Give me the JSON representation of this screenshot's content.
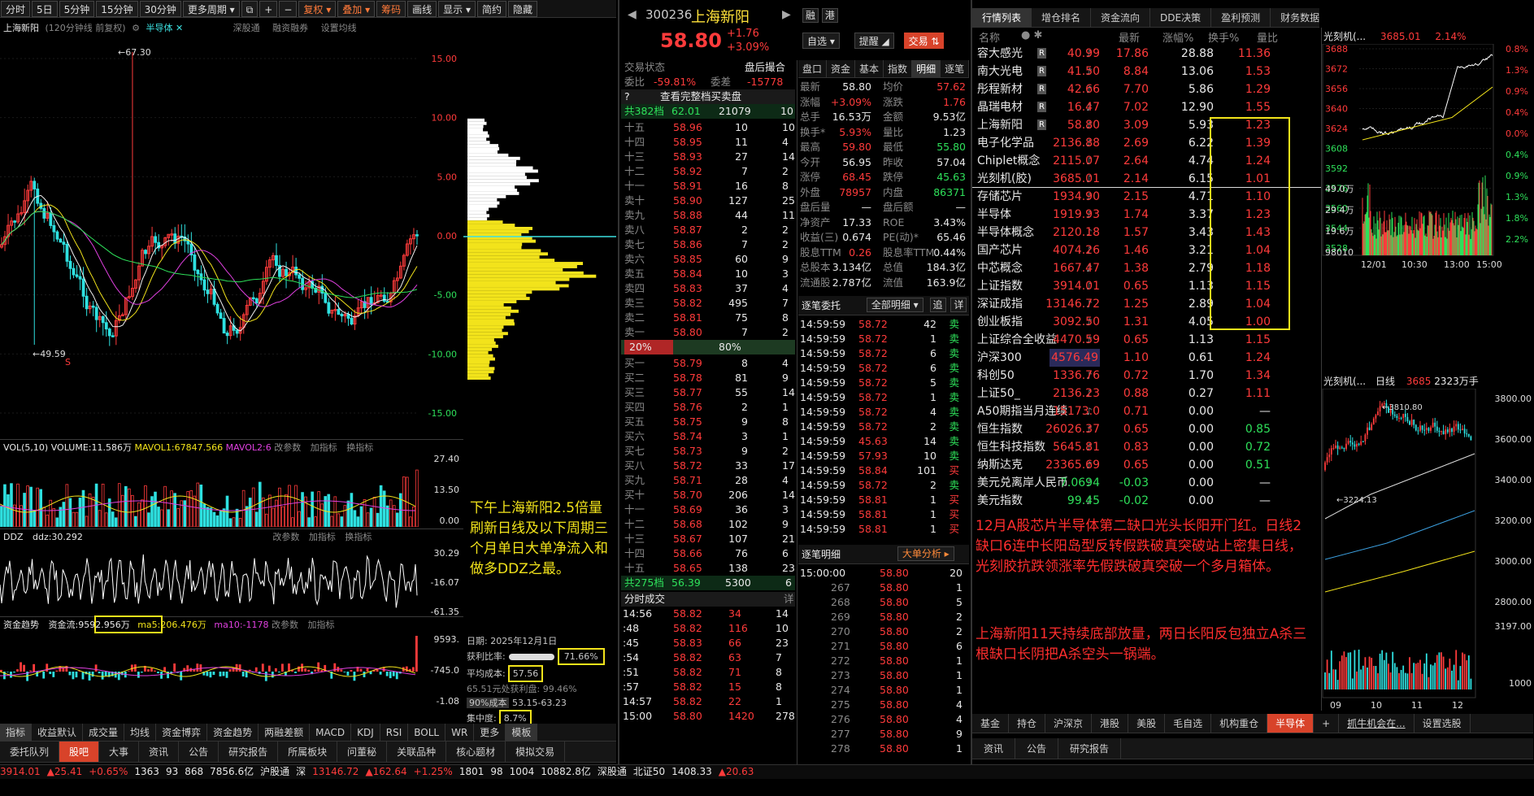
{
  "left": {
    "toolbar": [
      "分时",
      "5日",
      "5分钟",
      "15分钟",
      "30分钟",
      "更多周期",
      "",
      "+",
      "−",
      "复权",
      "叠加",
      "筹码",
      "画线",
      "显示",
      "简约",
      "隐藏"
    ],
    "title": "上海新阳",
    "subtitle": "(120分钟线 前复权)",
    "sector": "半导体",
    "links": [
      "深股通",
      "融资融券",
      "设置均线"
    ],
    "y_labels": [
      "15.00",
      "10.00",
      "5.00",
      "0.00",
      "-5.00",
      "-10.00",
      "-15.00"
    ],
    "high_mark": "67.30",
    "low_mark": "49.59",
    "vol_hdr": {
      "name": "VOL(5,10)",
      "vol": "VOLUME:11.586万",
      "ma1": "MAVOL1:67847.566",
      "ma2": "MAVOL2:6",
      "change": "改参数",
      "add": "加指标",
      "swap": "换指标"
    },
    "vol_y": [
      "27.40",
      "13.50",
      "0.00"
    ],
    "ddz_hdr": {
      "name": "DDZ",
      "val": "ddz:30.292"
    },
    "ddz_y": [
      "30.29",
      "-16.07",
      "-61.35"
    ],
    "flow_hdr": {
      "name": "资金趋势",
      "val": "资金流:9592.956万",
      "ma5": "ma5:206.476万",
      "ma10": "ma10:-1178"
    },
    "flow_y": [
      "9593.",
      "-745.0",
      "-1.08"
    ],
    "chip_info": {
      "date": "日期: 2025年12月1日",
      "ratio_label": "获利比率:",
      "ratio": "71.66%",
      "cost_label": "平均成本:",
      "cost": "57.56",
      "profit_line": "65.51元处获利盘: 99.46%",
      "cost90": "90%成本",
      "cost90_range": "53.15-63.23",
      "conc_label": "集中度:",
      "conc": "8.7%"
    },
    "annotation": "下午上海新阳2.5倍量刷新日线及以下周期三个月单日大单净流入和做多DDZ之最。",
    "bottom_tabs": [
      "指标",
      "收益默认",
      "成交量",
      "均线",
      "资金博弈",
      "资金趋势",
      "两融差额",
      "MACD",
      "KDJ",
      "RSI",
      "BOLL",
      "WR",
      "更多",
      "模板"
    ]
  },
  "quote": {
    "code": "300236",
    "name": "上海新阳",
    "price": "58.80",
    "chg": "+1.76",
    "pct": "+3.09%",
    "btns": [
      "融",
      "港",
      "自选",
      "提醒",
      "交易"
    ],
    "state_label": "交易状态",
    "state": "盘后撮合",
    "webi": "委比",
    "webi_v": "-59.81%",
    "weicha": "委差",
    "weicha_v": "-15778",
    "full_btn": "查看完整档买卖盘",
    "sell_total": "共382档",
    "sell_total_p": "62.01",
    "sell_total_v": "21079",
    "sell_total_n": "10",
    "sells": [
      [
        "十五",
        "58.96",
        "10",
        "10"
      ],
      [
        "十四",
        "58.95",
        "11",
        "4"
      ],
      [
        "十三",
        "58.93",
        "27",
        "14"
      ],
      [
        "十二",
        "58.92",
        "7",
        "2"
      ],
      [
        "十一",
        "58.91",
        "16",
        "8"
      ],
      [
        "卖十",
        "58.90",
        "127",
        "25"
      ],
      [
        "卖九",
        "58.88",
        "44",
        "11"
      ],
      [
        "卖八",
        "58.87",
        "2",
        "2"
      ],
      [
        "卖七",
        "58.86",
        "7",
        "2"
      ],
      [
        "卖六",
        "58.85",
        "60",
        "9"
      ],
      [
        "卖五",
        "58.84",
        "10",
        "3"
      ],
      [
        "卖四",
        "58.83",
        "37",
        "4"
      ],
      [
        "卖三",
        "58.82",
        "495",
        "7"
      ],
      [
        "卖二",
        "58.81",
        "75",
        "8"
      ],
      [
        "卖一",
        "58.80",
        "7",
        "2"
      ]
    ],
    "ratio_l": "20%",
    "ratio_r": "80%",
    "buys": [
      [
        "买一",
        "58.79",
        "8",
        "4"
      ],
      [
        "买二",
        "58.78",
        "81",
        "9"
      ],
      [
        "买三",
        "58.77",
        "55",
        "14"
      ],
      [
        "买四",
        "58.76",
        "2",
        "1"
      ],
      [
        "买五",
        "58.75",
        "9",
        "8"
      ],
      [
        "买六",
        "58.74",
        "3",
        "1"
      ],
      [
        "买七",
        "58.73",
        "9",
        "2"
      ],
      [
        "买八",
        "58.72",
        "33",
        "17"
      ],
      [
        "买九",
        "58.71",
        "28",
        "4"
      ],
      [
        "买十",
        "58.70",
        "206",
        "14"
      ],
      [
        "十一",
        "58.69",
        "36",
        "3"
      ],
      [
        "十二",
        "58.68",
        "102",
        "9"
      ],
      [
        "十三",
        "58.67",
        "107",
        "21"
      ],
      [
        "十四",
        "58.66",
        "76",
        "6"
      ],
      [
        "十五",
        "58.65",
        "138",
        "23"
      ]
    ],
    "buy_total": "共275档",
    "buy_total_p": "56.39",
    "buy_total_v": "5300",
    "buy_total_n": "6",
    "fs_title": "分时成交",
    "fs_more": "详",
    "fs": [
      [
        "14:56",
        "58.82",
        "34",
        "14"
      ],
      [
        ":48",
        "58.82",
        "116",
        "10"
      ],
      [
        ":45",
        "58.83",
        "66",
        "23"
      ],
      [
        ":54",
        "58.82",
        "63",
        "7"
      ],
      [
        ":51",
        "58.82",
        "71",
        "8"
      ],
      [
        ":57",
        "58.82",
        "15",
        "8"
      ],
      [
        "14:57",
        "58.82",
        "22",
        "1"
      ],
      [
        "15:00",
        "58.80",
        "1420",
        "278"
      ]
    ]
  },
  "detail": {
    "tabs": [
      "盘口",
      "资金",
      "基本",
      "指数",
      "明细",
      "逐笔"
    ],
    "stats": [
      [
        "最新",
        "58.80",
        "均价",
        "57.62"
      ],
      [
        "涨幅",
        "+3.09%",
        "涨跌",
        "1.76"
      ],
      [
        "总手",
        "16.53万",
        "金额",
        "9.53亿"
      ],
      [
        "换手*",
        "5.93%",
        "量比",
        "1.23"
      ],
      [
        "最高",
        "59.80",
        "最低",
        "55.80"
      ],
      [
        "今开",
        "56.95",
        "昨收",
        "57.04"
      ],
      [
        "涨停",
        "68.45",
        "跌停",
        "45.63"
      ],
      [
        "外盘",
        "78957",
        "内盘",
        "86371"
      ],
      [
        "盘后量",
        "—",
        "盘后额",
        "—"
      ],
      [
        "净资产",
        "17.33",
        "ROE",
        "3.43%"
      ],
      [
        "收益(三)",
        "0.674",
        "PE(动)*",
        "65.46"
      ],
      [
        "股息TTM",
        "0.26",
        "股息率TTM",
        "0.44%"
      ],
      [
        "总股本",
        "3.134亿",
        "总值",
        "184.3亿"
      ],
      [
        "流通股",
        "2.787亿",
        "流值",
        "163.9亿"
      ]
    ],
    "zb_title": "逐笔委托",
    "zb_sel": "全部明细",
    "zb_more": "追",
    "zb_more2": "详",
    "zb": [
      [
        "14:59:59",
        "58.72",
        "42",
        "卖"
      ],
      [
        "14:59:59",
        "58.72",
        "1",
        "卖"
      ],
      [
        "14:59:59",
        "58.72",
        "6",
        "卖"
      ],
      [
        "14:59:59",
        "58.72",
        "6",
        "卖"
      ],
      [
        "14:59:59",
        "58.72",
        "5",
        "卖"
      ],
      [
        "14:59:59",
        "58.72",
        "1",
        "卖"
      ],
      [
        "14:59:59",
        "58.72",
        "4",
        "卖"
      ],
      [
        "14:59:59",
        "58.72",
        "2",
        "卖"
      ],
      [
        "14:59:59",
        "45.63",
        "14",
        "卖"
      ],
      [
        "14:59:59",
        "57.93",
        "10",
        "卖"
      ],
      [
        "14:59:59",
        "58.84",
        "101",
        "买"
      ],
      [
        "14:59:59",
        "58.72",
        "2",
        "卖"
      ],
      [
        "14:59:59",
        "58.81",
        "1",
        "买"
      ],
      [
        "14:59:59",
        "58.81",
        "1",
        "买"
      ],
      [
        "14:59:59",
        "58.81",
        "1",
        "买"
      ]
    ],
    "mx_title": "逐笔明细",
    "mx_btn": "大单分析",
    "mx": [
      [
        "15:00:00",
        "58.80",
        "20"
      ],
      [
        "267",
        "58.80",
        "1"
      ],
      [
        "268",
        "58.80",
        "5"
      ],
      [
        "269",
        "58.80",
        "2"
      ],
      [
        "270",
        "58.80",
        "2"
      ],
      [
        "271",
        "58.80",
        "6"
      ],
      [
        "272",
        "58.80",
        "1"
      ],
      [
        "273",
        "58.80",
        "1"
      ],
      [
        "274",
        "58.80",
        "1"
      ],
      [
        "275",
        "58.80",
        "4"
      ],
      [
        "276",
        "58.80",
        "4"
      ],
      [
        "277",
        "58.80",
        "9"
      ],
      [
        "278",
        "58.80",
        "1"
      ]
    ]
  },
  "list": {
    "tabs": [
      "行情列表",
      "增仓排名",
      "资金流向",
      "DDE决策",
      "盈利预测",
      "财务数据",
      "阶段统计",
      "更多"
    ],
    "headers": [
      "名称",
      "最新",
      "涨幅%",
      "换手%",
      "量比"
    ],
    "rows": [
      [
        "容大感光",
        "R",
        "40.99",
        "17.86",
        "28.88",
        "11.36",
        "r"
      ],
      [
        "南大光电",
        "R",
        "41.50",
        "8.84",
        "13.06",
        "1.53",
        "r"
      ],
      [
        "彤程新材",
        "R",
        "42.66",
        "7.70",
        "5.86",
        "1.29",
        "r"
      ],
      [
        "晶瑞电材",
        "R",
        "16.47",
        "7.02",
        "12.90",
        "1.55",
        "r"
      ],
      [
        "上海新阳",
        "R",
        "58.80",
        "3.09",
        "5.93",
        "1.23",
        "r"
      ],
      [
        "电子化学品",
        "",
        "2136.88",
        "2.69",
        "6.22",
        "1.39",
        "r"
      ],
      [
        "Chiplet概念",
        "",
        "2115.07",
        "2.64",
        "4.74",
        "1.24",
        "r"
      ],
      [
        "光刻机(胶)",
        "",
        "3685.01",
        "2.14",
        "6.15",
        "1.01",
        "r"
      ],
      [
        "存储芯片",
        "",
        "1934.90",
        "2.15",
        "4.71",
        "1.10",
        "r"
      ],
      [
        "半导体",
        "",
        "1919.93",
        "1.74",
        "3.37",
        "1.23",
        "r"
      ],
      [
        "半导体概念",
        "",
        "2120.18",
        "1.57",
        "3.43",
        "1.43",
        "r"
      ],
      [
        "国产芯片",
        "",
        "4074.26",
        "1.46",
        "3.21",
        "1.04",
        "r"
      ],
      [
        "中芯概念",
        "",
        "1667.47",
        "1.38",
        "2.79",
        "1.18",
        "r"
      ],
      [
        "上证指数",
        "",
        "3914.01",
        "0.65",
        "1.13",
        "1.15",
        "r"
      ],
      [
        "深证成指",
        "",
        "13146.72",
        "1.25",
        "2.89",
        "1.04",
        "r"
      ],
      [
        "创业板指",
        "",
        "3092.50",
        "1.31",
        "4.05",
        "1.00",
        "r"
      ],
      [
        "上证综合全收益",
        "",
        "4470.59",
        "0.65",
        "1.13",
        "1.15",
        "r"
      ],
      [
        "沪深300",
        "",
        "4576.49",
        "1.10",
        "0.61",
        "1.24",
        "r"
      ],
      [
        "科创50",
        "",
        "1336.76",
        "0.72",
        "1.70",
        "1.34",
        "r"
      ],
      [
        "上证50_",
        "",
        "2136.23",
        "0.88",
        "0.27",
        "1.11",
        "r"
      ],
      [
        "A50期指当月连续",
        "",
        "15173.0",
        "0.71",
        "0.00",
        "—",
        "r"
      ],
      [
        "恒生指数",
        "",
        "26026.37",
        "0.65",
        "0.00",
        "0.85",
        "r"
      ],
      [
        "恒生科技指数",
        "",
        "5645.81",
        "0.83",
        "0.00",
        "0.72",
        "r"
      ],
      [
        "纳斯达克",
        "",
        "23365.69",
        "0.65",
        "0.00",
        "0.51",
        "r"
      ],
      [
        "美元兑离岸人民币",
        "",
        "7.0694",
        "-0.03",
        "0.00",
        "—",
        "g"
      ],
      [
        "美元指数",
        "",
        "99.45",
        "-0.02",
        "0.00",
        "—",
        "g"
      ]
    ],
    "annotation1": "12月A股芯片半导体第二缺口光头长阳开门红。日线2缺口6连中长阳岛型反转假跌破真突破站上密集日线，光刻胶抗跌领涨率先假跌破真突破一个多月箱体。",
    "annotation2": "上海新阳11天持续底部放量，两日长阳反包独立A杀三根缺口长阴把A杀空头一锅端。",
    "bottom_tabs": [
      "基金",
      "持仓",
      "沪深京",
      "港股",
      "美股",
      "毛自选",
      "机构重仓",
      "半导体",
      "+",
      "抓牛机会在...",
      "设置选股"
    ]
  },
  "mini": {
    "title": "光刻机(...",
    "price": "3685.01",
    "pct": "2.14%",
    "y": [
      "3688",
      "3672",
      "3656",
      "3640",
      "3624",
      "3608",
      "3592",
      "3576",
      "3560",
      "3544",
      "3528"
    ],
    "pcty": [
      "0.8%",
      "1.3%",
      "0.9%",
      "0.4%",
      "0.0%",
      "0.4%",
      "0.9%",
      "1.3%",
      "1.8%",
      "2.2%"
    ],
    "vol_y": [
      "49.0万",
      "29.4万",
      "19.6万",
      "98010"
    ],
    "times": [
      "12/01",
      "10:30",
      "13:00",
      "15:00"
    ],
    "k_title": "光刻机(...",
    "k_sub": "日线",
    "k_val": "3685",
    "k_vol": "2323万手",
    "k_high": "3810.80",
    "k_low": "3224.13",
    "k_y": [
      "3800.00",
      "3600.00",
      "3400.00",
      "3200.00",
      "3000.00",
      "2800.00"
    ],
    "k_vy": [
      "3197.00",
      "1000"
    ],
    "k_x": [
      "09",
      "10",
      "11",
      "12"
    ]
  },
  "status": {
    "left": [
      "3914.01",
      "▲25.41",
      "+0.65%",
      "1363",
      "93",
      "868",
      "7856.6亿",
      "沪股通",
      "深",
      "13146.72",
      "▲162.64",
      "+1.25%",
      "1801",
      "98",
      "1004",
      "10882.8亿",
      "深股通",
      "北证50",
      "1408.33",
      "▲20.63"
    ],
    "bottom_tabs_l": [
      "委托队列",
      "股吧",
      "大事",
      "资讯",
      "公告",
      "研究报告",
      "所属板块",
      "问董秘",
      "关联品种",
      "核心题材",
      "模拟交易"
    ],
    "bottom_tabs_r": [
      "资讯",
      "公告",
      "研究报告"
    ]
  },
  "colors": {
    "up": "#ff3b3b",
    "down": "#2ee05a",
    "accent": "#d8432a",
    "hl": "#f2e31b"
  }
}
